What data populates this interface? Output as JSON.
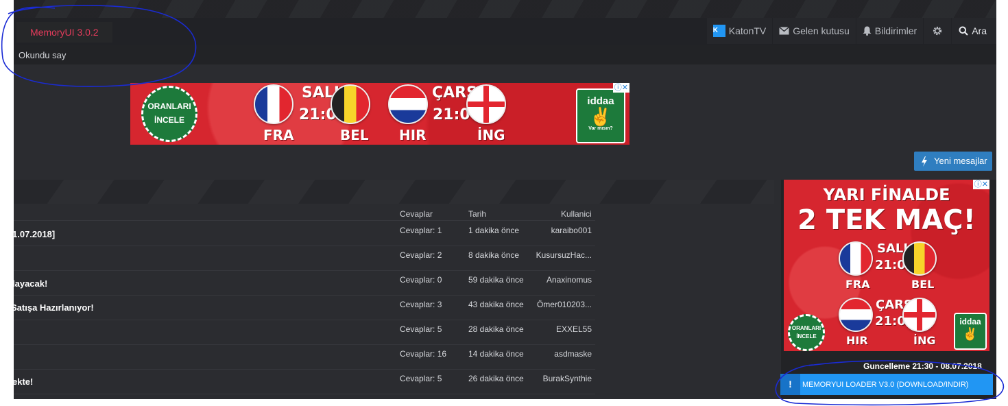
{
  "header": {
    "logo": "MemoryUI 3.0.2",
    "nav": [
      {
        "label": "KatonTV",
        "icon": "katontv-logo-icon"
      },
      {
        "label": "Gelen kutusu",
        "icon": "envelope-icon"
      },
      {
        "label": "Bildirimler",
        "icon": "bell-icon"
      },
      {
        "label": "",
        "icon": "settings-gear-icon"
      },
      {
        "label": "Ara",
        "icon": "search-icon"
      }
    ]
  },
  "subnav": {
    "mark_read": "Okundu say"
  },
  "ad_top": {
    "cta_line1": "ORANLARI",
    "cta_line2": "İNCELE",
    "match1": {
      "day": "SALI",
      "time": "21:00",
      "home": "FRA",
      "away": "BEL"
    },
    "match2": {
      "day": "ÇARŞ",
      "time": "21:00",
      "home": "HIR",
      "away": "İNG"
    },
    "brand": "iddaa",
    "brand_sub": "Var mısın?"
  },
  "new_posts_button": "Yeni mesajlar",
  "thread_list": {
    "columns": [
      "Cevaplar",
      "Tarih",
      "Kullanici"
    ],
    "rows": [
      {
        "title": "1.07.2018]",
        "replies": "Cevaplar: 1",
        "date": "1 dakika önce",
        "user": "karaibo001"
      },
      {
        "title": "",
        "replies": "Cevaplar: 2",
        "date": "8 dakika önce",
        "user": "KusursuzHac..."
      },
      {
        "title": "layacak!",
        "replies": "Cevaplar: 0",
        "date": "59 dakika önce",
        "user": "Anaxinomus"
      },
      {
        "title": "Satışa Hazırlanıyor!",
        "replies": "Cevaplar: 3",
        "date": "43 dakika önce",
        "user": "Ömer010203..."
      },
      {
        "title": "",
        "replies": "Cevaplar: 5",
        "date": "28 dakika önce",
        "user": "EXXEL55"
      },
      {
        "title": "",
        "replies": "Cevaplar: 16",
        "date": "14 dakika önce",
        "user": "asdmaske"
      },
      {
        "title": "ekte!",
        "replies": "Cevaplar: 5",
        "date": "26 dakika önce",
        "user": "BurakSynthie"
      }
    ]
  },
  "ad_side": {
    "headline1": "YARI FİNALDE",
    "headline2": "2 TEK MAÇ!",
    "match1": {
      "day": "SALI",
      "time": "21:00",
      "home": "FRA",
      "away": "BEL"
    },
    "match2": {
      "day": "ÇARŞ",
      "time": "21:00",
      "home": "HIR",
      "away": "İNG"
    },
    "cta_line1": "ORANLARI",
    "cta_line2": "İNCELE",
    "brand": "iddaa"
  },
  "update_text": "Guncelleme 21:30 - 08.07.2018",
  "loader_link": "MEMORYUI LOADER V3.0 (DOWNLOAD/INDIR)",
  "ad_choices": "ⓘ✕",
  "colors": {
    "accent_red": "#e33b5b",
    "button_blue": "#2f7ec0",
    "loader_blue": "#2196f3",
    "annotation": "#1a2bd4"
  }
}
